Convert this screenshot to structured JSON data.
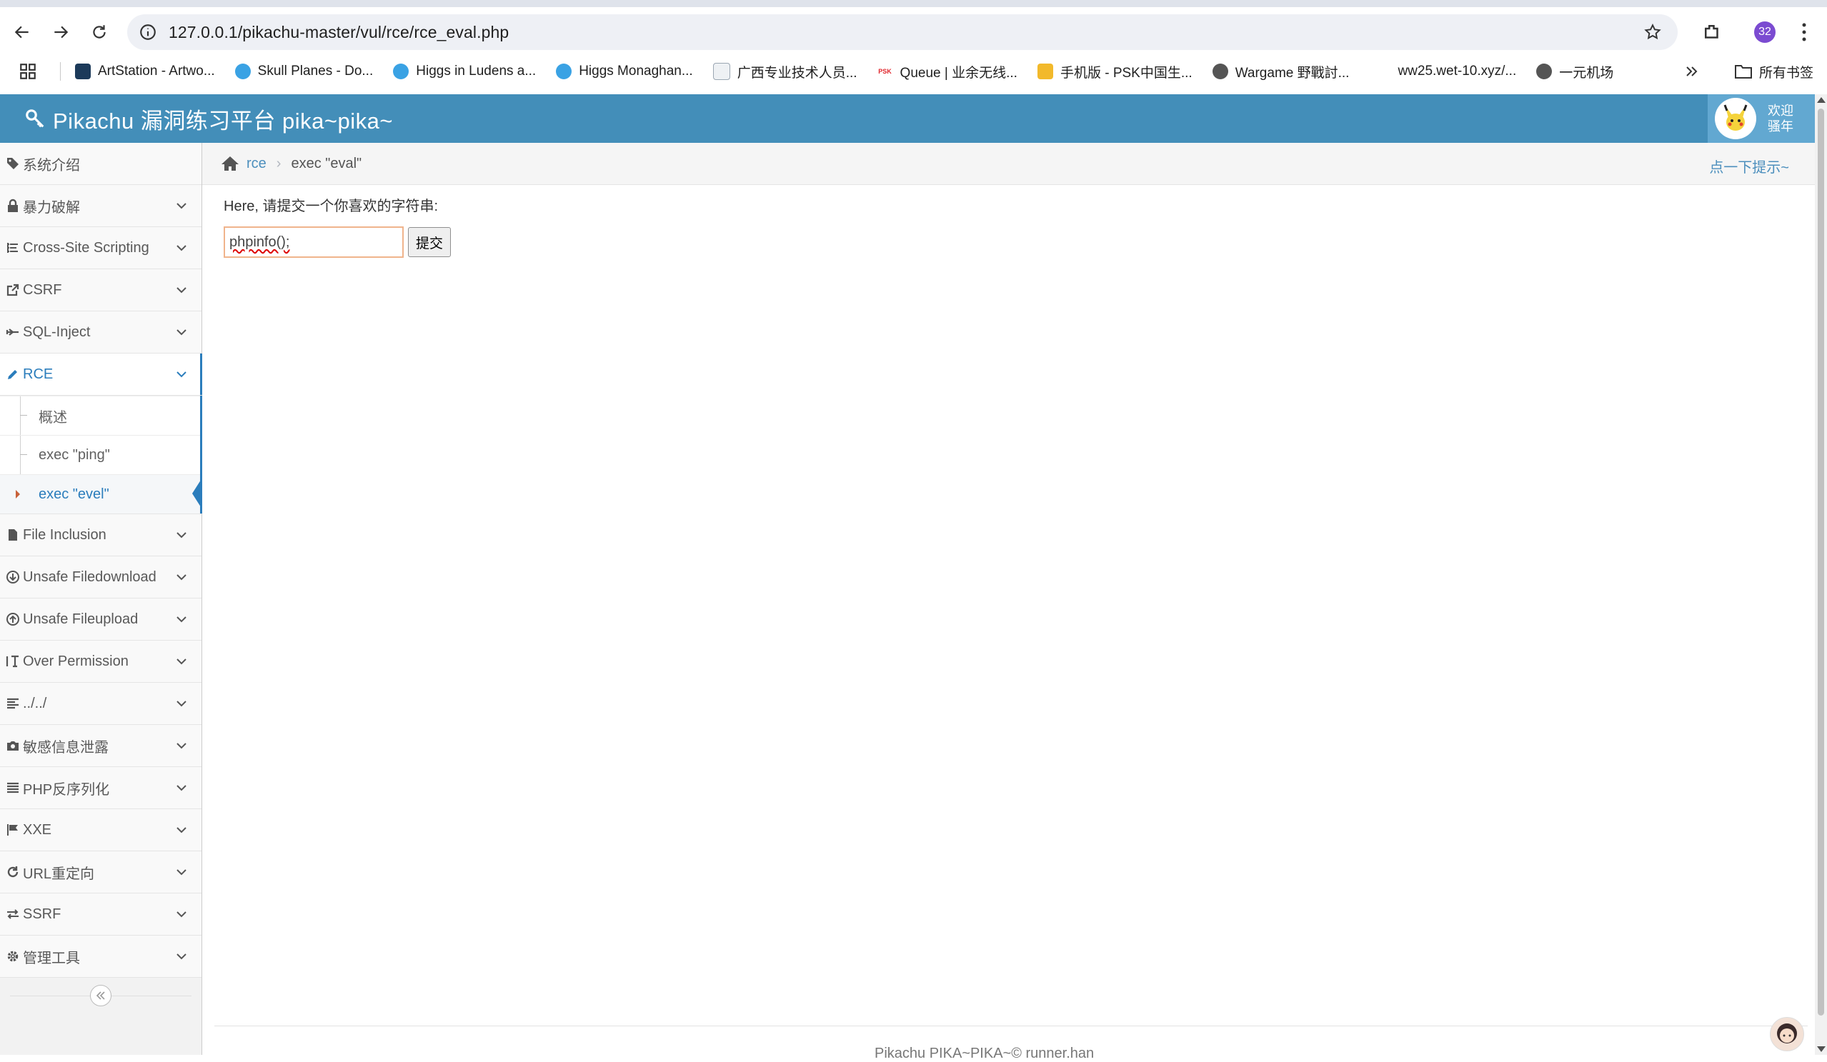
{
  "browser": {
    "url": "127.0.0.1/pikachu-master/vul/rce/rce_eval.php",
    "profile_badge": "32",
    "bookmarks": [
      {
        "label": "ArtStation - Artwo...",
        "color": "#13aff0"
      },
      {
        "label": "Skull Planes - Do...",
        "color": "#3aa2e4"
      },
      {
        "label": "Higgs in Ludens a...",
        "color": "#3aa2e4"
      },
      {
        "label": "Higgs Monaghan...",
        "color": "#3aa2e4"
      },
      {
        "label": "广西专业技术人员...",
        "color": "#9aa6b2"
      },
      {
        "label": "Queue | 业余无线...",
        "color": "#e0262c"
      },
      {
        "label": "手机版 - PSK中国生...",
        "color": "#f2b92b"
      },
      {
        "label": "Wargame 野戰討...",
        "color": "#555555"
      },
      {
        "label": "ww25.wet-10.xyz/...",
        "color": "#ffffff"
      },
      {
        "label": "一元机场",
        "color": "#555555"
      }
    ],
    "all_bookmarks": "所有书签"
  },
  "header": {
    "brand": "Pikachu 漏洞练习平台 pika~pika~",
    "welcome_line1": "欢迎",
    "welcome_line2": "骚年",
    "color": "#438eb9"
  },
  "sidebar": {
    "intro": "系统介绍",
    "items_top": [
      {
        "label": "暴力破解",
        "icon": "lock-icon"
      },
      {
        "label": "Cross-Site Scripting",
        "icon": "list-icon"
      },
      {
        "label": "CSRF",
        "icon": "external-link-icon"
      },
      {
        "label": "SQL-Inject",
        "icon": "fighter-jet-icon"
      }
    ],
    "rce": {
      "label": "RCE",
      "subitems": [
        "概述",
        "exec \"ping\"",
        "exec \"evel\""
      ]
    },
    "items_bottom": [
      {
        "label": "File Inclusion",
        "icon": "file-icon"
      },
      {
        "label": "Unsafe Filedownload",
        "icon": "download-icon"
      },
      {
        "label": "Unsafe Fileupload",
        "icon": "upload-icon"
      },
      {
        "label": "Over Permission",
        "icon": "text-height-icon"
      },
      {
        "label": "../../",
        "icon": "align-left-icon"
      },
      {
        "label": "敏感信息泄露",
        "icon": "camera-icon"
      },
      {
        "label": "PHP反序列化",
        "icon": "align-justify-icon"
      },
      {
        "label": "XXE",
        "icon": "flag-icon"
      },
      {
        "label": "URL重定向",
        "icon": "refresh-icon"
      },
      {
        "label": "SSRF",
        "icon": "exchange-icon"
      },
      {
        "label": "管理工具",
        "icon": "cog-icon"
      }
    ]
  },
  "breadcrumb": {
    "link": "rce",
    "current": "exec \"eval\"",
    "hint": "点一下提示~"
  },
  "form": {
    "prompt": "Here, 请提交一个你喜欢的字符串:",
    "input_value": "phpinfo();",
    "submit_label": "提交"
  },
  "footer": {
    "text": "Pikachu PIKA~PIKA~© runner.han"
  }
}
